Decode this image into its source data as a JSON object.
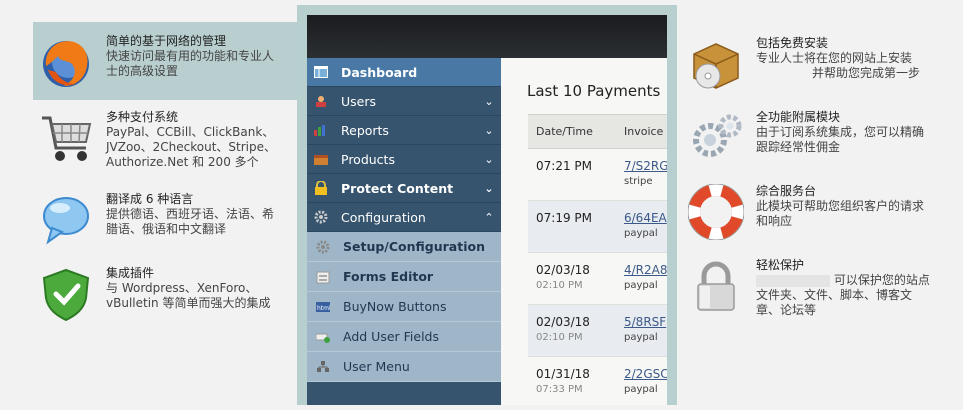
{
  "features_left": [
    {
      "title": "简单的基于网络的管理",
      "desc": [
        "快速访问最有用的功能和专业人",
        "士的高级设置"
      ],
      "icon": "firefox-icon",
      "active": true
    },
    {
      "title": "多种支付系统",
      "desc": [
        "PayPal、CCBill、ClickBank、",
        "JVZoo、2Checkout、Stripe、",
        "Authorize.Net 和 200 多个"
      ],
      "icon": "shopping-cart-icon"
    },
    {
      "title": "翻译成 6 种语言",
      "desc": [
        "提供德语、西班牙语、法语、希",
        "腊语、俄语和中文翻译"
      ],
      "icon": "speech-bubble-icon"
    },
    {
      "title": "集成插件",
      "desc": [
        "与 Wordpress、XenForo、",
        "vBulletin 等简单而强大的集成"
      ],
      "icon": "shield-check-icon"
    }
  ],
  "features_right": [
    {
      "title": "包括免费安装",
      "desc": [
        "专业人士将在您的网站上安装",
        "并帮助您完成第一步"
      ],
      "icon": "box-cd-icon"
    },
    {
      "title": "全功能附属模块",
      "desc": [
        "由于订阅系统集成，您可以精确",
        "跟踪经常性佣金"
      ],
      "icon": "gears-icon"
    },
    {
      "title": "综合服务台",
      "desc": [
        "此模块可帮助您组织客户的请求",
        "和响应"
      ],
      "icon": "lifebuoy-icon"
    },
    {
      "title": "轻松保护",
      "desc": [
        "可以保护您的站点",
        "文件夹、文件、脚本、博客文",
        "章、论坛等"
      ],
      "icon": "padlock-icon"
    }
  ],
  "nav": [
    {
      "label": "Dashboard",
      "icon": "dashboard-icon",
      "active": true
    },
    {
      "label": "Users",
      "icon": "users-icon",
      "chevron": "down"
    },
    {
      "label": "Reports",
      "icon": "reports-icon",
      "chevron": "down"
    },
    {
      "label": "Products",
      "icon": "products-icon",
      "chevron": "down"
    },
    {
      "label": "Protect Content",
      "icon": "lock-icon",
      "chevron": "down",
      "bold": true
    },
    {
      "label": "Configuration",
      "icon": "gear-icon",
      "chevron": "up"
    }
  ],
  "subnav": [
    {
      "label": "Setup/Configuration",
      "icon": "setup-gear-icon",
      "bold": true
    },
    {
      "label": "Forms Editor",
      "icon": "forms-icon",
      "bold": true
    },
    {
      "label": "BuyNow Buttons",
      "icon": "html-icon"
    },
    {
      "label": "Add User Fields",
      "icon": "add-field-icon"
    },
    {
      "label": "User Menu",
      "icon": "user-menu-icon"
    }
  ],
  "payments": {
    "title": "Last 10 Payments",
    "columns": [
      "Date/Time",
      "Invoice"
    ],
    "rows": [
      {
        "date": "07:21 PM",
        "time": "",
        "invoice": "7/S2RG",
        "method": "stripe"
      },
      {
        "date": "07:19 PM",
        "time": "",
        "invoice": "6/64EA",
        "method": "paypal"
      },
      {
        "date": "02/03/18",
        "time": "02:10 PM",
        "invoice": "4/R2A8",
        "method": "paypal"
      },
      {
        "date": "02/03/18",
        "time": "02:10 PM",
        "invoice": "5/8RSF",
        "method": "paypal"
      },
      {
        "date": "01/31/18",
        "time": "07:33 PM",
        "invoice": "2/2GSC",
        "method": "paypal"
      }
    ]
  }
}
